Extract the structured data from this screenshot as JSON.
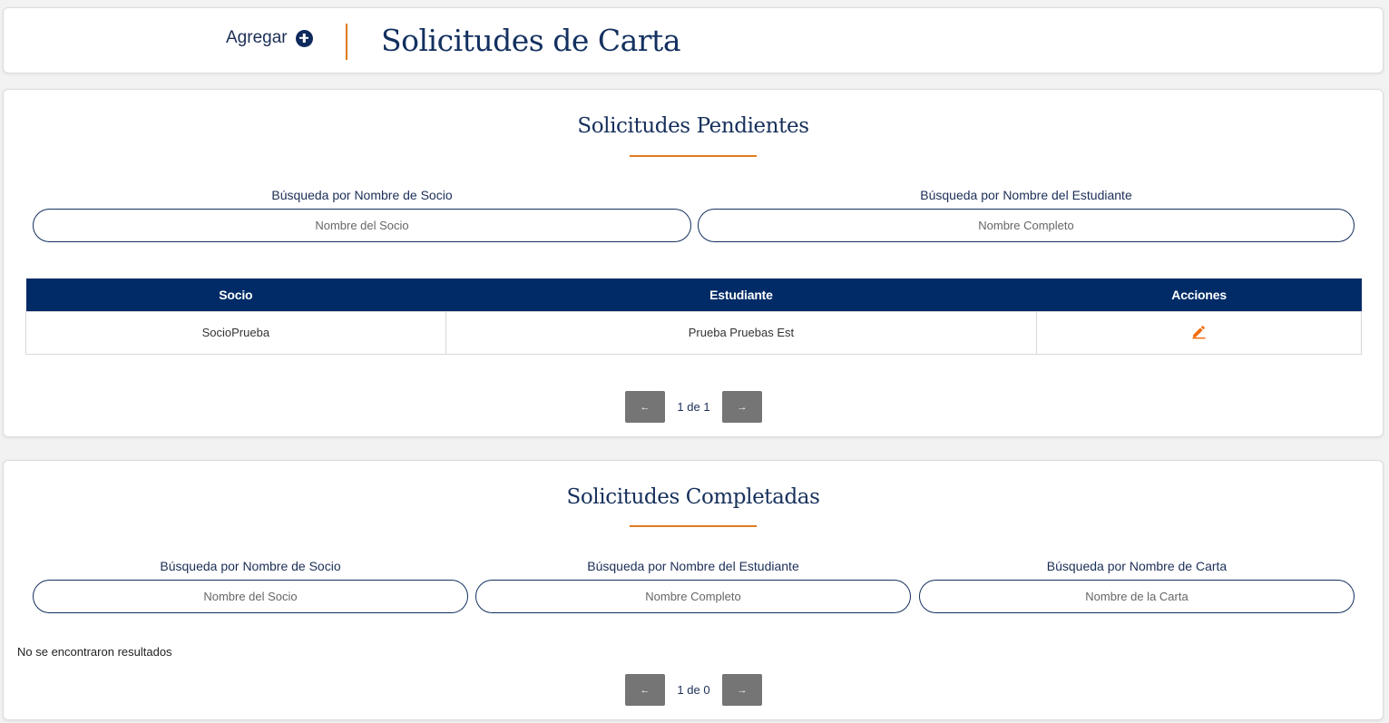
{
  "header": {
    "add_label": "Agregar",
    "title": "Solicitudes de Carta"
  },
  "pending": {
    "title": "Solicitudes Pendientes",
    "search_socio_label": "Búsqueda por Nombre de Socio",
    "search_socio_placeholder": "Nombre del Socio",
    "search_student_label": "Búsqueda por Nombre del Estudiante",
    "search_student_placeholder": "Nombre Completo",
    "columns": [
      "Socio",
      "Estudiante",
      "Acciones"
    ],
    "rows": [
      {
        "socio": "SocioPrueba",
        "estudiante": "Prueba Pruebas Est"
      }
    ],
    "pagination": {
      "prev": "←",
      "text": "1 de 1",
      "next": "→"
    }
  },
  "completed": {
    "title": "Solicitudes Completadas",
    "search_socio_label": "Búsqueda por Nombre de Socio",
    "search_socio_placeholder": "Nombre del Socio",
    "search_student_label": "Búsqueda por Nombre del Estudiante",
    "search_student_placeholder": "Nombre Completo",
    "search_letter_label": "Búsqueda por Nombre de Carta",
    "search_letter_placeholder": "Nombre de la Carta",
    "empty_message": "No se encontraron resultados",
    "pagination": {
      "prev": "←",
      "text": "1 de 0",
      "next": "→"
    }
  },
  "colors": {
    "primary": "#002b67",
    "accent": "#e07a1f",
    "edit_icon": "#f26c0d",
    "pager_button": "#757575"
  },
  "icons": {
    "add": "plus-circle-icon",
    "edit": "pencil-icon",
    "prev": "arrow-left-icon",
    "next": "arrow-right-icon"
  }
}
